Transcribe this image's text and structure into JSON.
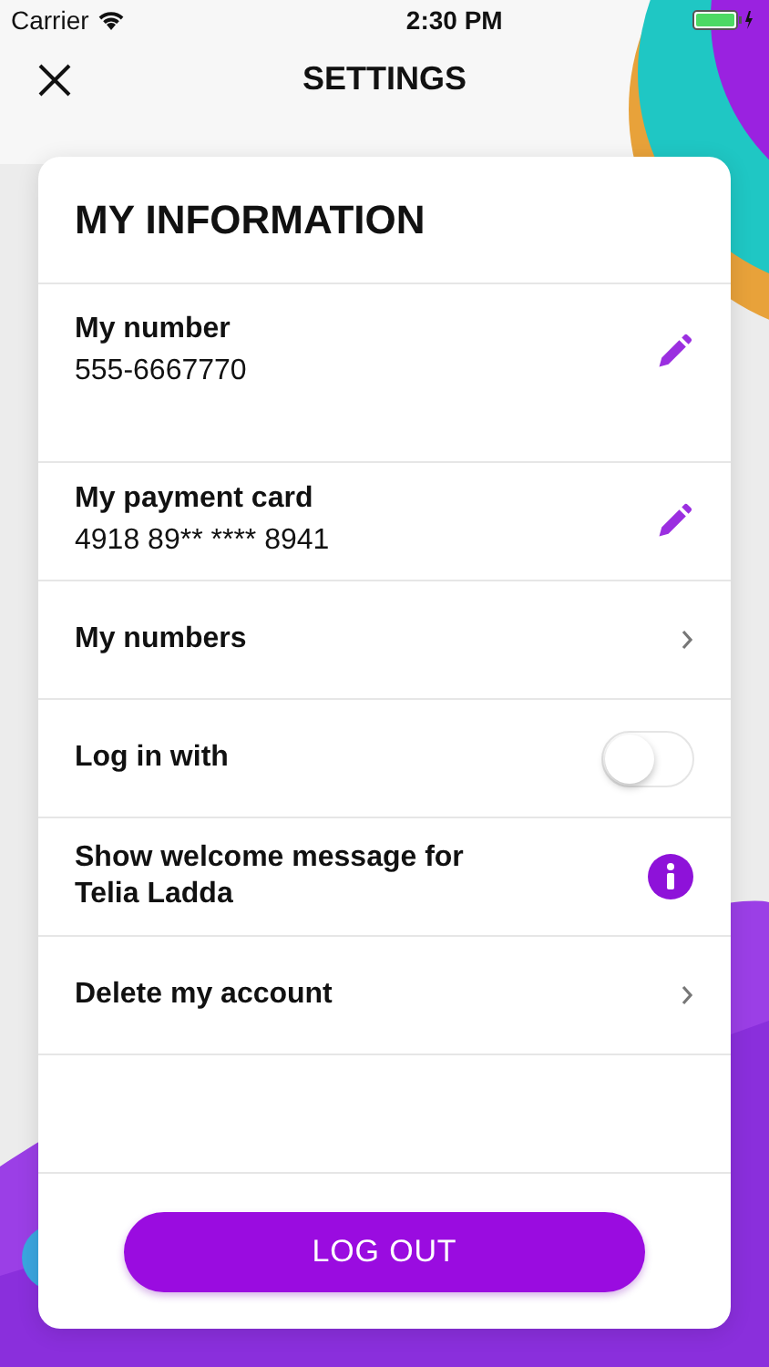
{
  "status_bar": {
    "carrier": "Carrier",
    "time": "2:30 PM"
  },
  "header": {
    "title": "SETTINGS"
  },
  "card": {
    "title": "MY INFORMATION",
    "rows": [
      {
        "kind": "edit",
        "label": "My number",
        "value": "555-6667770"
      },
      {
        "kind": "edit",
        "label": "My payment card",
        "value": "4918 89** **** 8941"
      },
      {
        "kind": "link",
        "label": "My numbers"
      },
      {
        "kind": "toggle",
        "label": "Log in with",
        "on": false
      },
      {
        "kind": "info",
        "label": "Show welcome message for Telia Ladda"
      },
      {
        "kind": "link",
        "label": "Delete my account"
      }
    ],
    "button": "LOG OUT"
  }
}
